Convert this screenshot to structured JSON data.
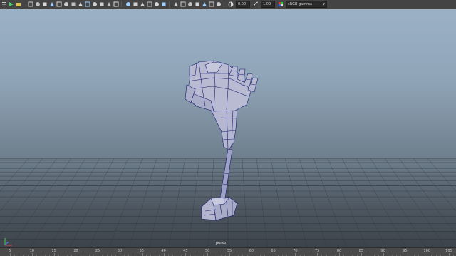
{
  "toolbar": {
    "left_icons": [
      "grid-icon",
      "camera-attributes-icon",
      "bookmark-icon",
      "image-plane-icon",
      "grease-pencil-icon",
      "two-d-pan-icon",
      "frame-all-icon",
      "film-gate-icon",
      "resolution-gate-icon",
      "gate-mask-icon",
      "field-chart-icon",
      "safe-action-icon",
      "safe-title-icon",
      "wireframe-icon",
      "smooth-shade-icon",
      "textured-icon",
      "use-lights-icon",
      "shadows-icon",
      "ambient-occlusion-icon",
      "motion-blur-icon",
      "anti-aliasing-icon",
      "depth-of-field-icon",
      "xray-icon",
      "xray-joints-icon",
      "isolate-select-icon",
      "backface-culling-icon"
    ],
    "exposure_value": "0.00",
    "gamma_value": "1.00",
    "color_space": "sRGB gamma"
  },
  "viewport": {
    "camera_label": "persp",
    "background_top": "#9bb1c6",
    "background_bottom": "#3c434a",
    "grid_color": "#2e3338",
    "wireframe_color": "#1a1d6e",
    "mesh_color": "#b4b7cf"
  },
  "timeslider": {
    "ticks": [
      "5",
      "10",
      "15",
      "20",
      "25",
      "30",
      "35",
      "40",
      "45",
      "50",
      "55",
      "60",
      "65",
      "70",
      "75",
      "80",
      "85",
      "90",
      "95",
      "100",
      "105"
    ]
  }
}
